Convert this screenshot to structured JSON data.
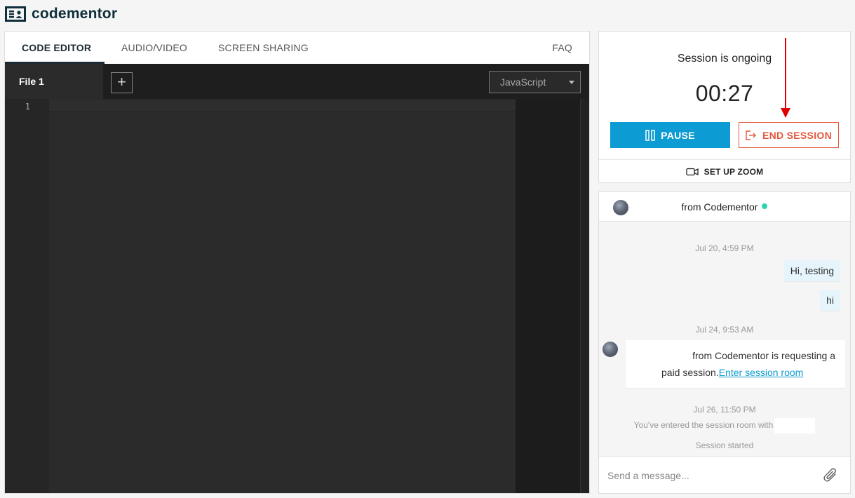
{
  "brand": {
    "name": "codementor"
  },
  "tabs": [
    {
      "label": "CODE EDITOR"
    },
    {
      "label": "AUDIO/VIDEO"
    },
    {
      "label": "SCREEN SHARING"
    },
    {
      "label": "FAQ"
    }
  ],
  "editor": {
    "file_tab": "File 1",
    "add_file_symbol": "+",
    "language": "JavaScript",
    "line_numbers": [
      "1"
    ]
  },
  "session": {
    "status": "Session is ongoing",
    "timer": "00:27",
    "pause_label": "PAUSE",
    "end_label": "END SESSION",
    "zoom_label": "SET UP ZOOM"
  },
  "chat": {
    "title": "from Codementor",
    "timestamps": [
      "Jul 20, 4:59 PM",
      "Jul 24, 9:53 AM",
      "Jul 26, 11:50 PM"
    ],
    "messages_out": [
      "Hi, testing",
      "hi"
    ],
    "request_text": "from Codementor is requesting a",
    "request_text2": "paid session.",
    "request_link": "Enter session room",
    "system_entered": "You've entered the session room with",
    "system_started": "Session started",
    "input_placeholder": "Send a message..."
  },
  "colors": {
    "primary": "#0c9bd2",
    "danger": "#e4573d",
    "online": "#2ed1b0",
    "annotation_arrow": "#e00000"
  }
}
